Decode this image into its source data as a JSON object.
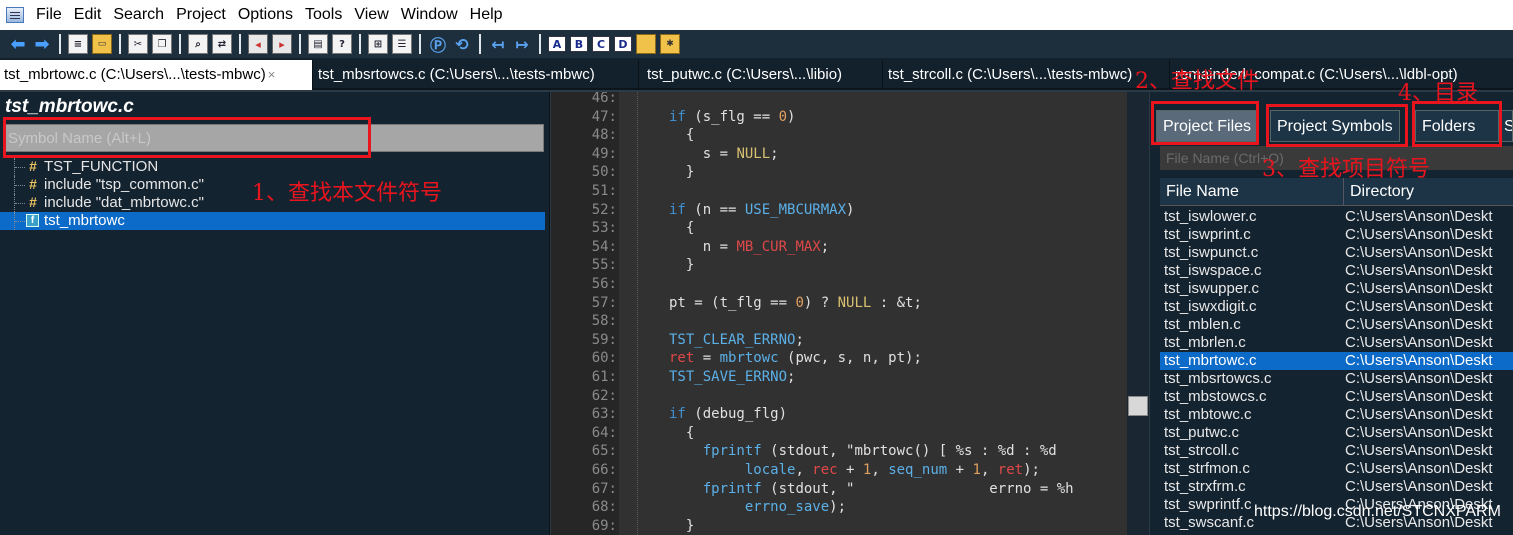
{
  "menu": [
    "File",
    "Edit",
    "Search",
    "Project",
    "Options",
    "Tools",
    "View",
    "Window",
    "Help"
  ],
  "toolbar": {
    "letters": [
      "A",
      "B",
      "C",
      "D"
    ]
  },
  "tabs": [
    {
      "label": "tst_mbrtowc.c (C:\\Users\\...\\tests-mbwc)",
      "active": true,
      "close": "×"
    },
    {
      "label": "tst_mbsrtowcs.c (C:\\Users\\...\\tests-mbwc)",
      "active": false
    },
    {
      "label": "tst_putwc.c (C:\\Users\\...\\libio)",
      "active": false
    },
    {
      "label": "tst_strcoll.c (C:\\Users\\...\\tests-mbwc)",
      "active": false
    },
    {
      "label": "remainderl_compat.c (C:\\Users\\...\\ldbl-opt)",
      "active": false
    }
  ],
  "left_panel": {
    "title": "tst_mbrtowc.c",
    "search_placeholder": "Symbol Name (Alt+L)",
    "symbols": [
      {
        "icon": "hash-icon",
        "label": "TST_FUNCTION",
        "selected": false
      },
      {
        "icon": "hash-icon",
        "label": "include \"tsp_common.c\"",
        "selected": false
      },
      {
        "icon": "hash-icon",
        "label": "include \"dat_mbrtowc.c\"",
        "selected": false
      },
      {
        "icon": "function-icon",
        "label": "tst_mbrtowc",
        "selected": true
      }
    ]
  },
  "editor": {
    "lines": [
      {
        "n": "46:",
        "html": ""
      },
      {
        "n": "47:",
        "html": "<span class=\"kw\">if</span> (s_flg == <span class=\"num\">0</span>)"
      },
      {
        "n": "48:",
        "html": "  {"
      },
      {
        "n": "49:",
        "html": "    s = <span class=\"yel\">NULL</span>;"
      },
      {
        "n": "50:",
        "html": "  }"
      },
      {
        "n": "51:",
        "html": ""
      },
      {
        "n": "52:",
        "html": "<span class=\"kw\">if</span> (n == <span class=\"cyan\">USE_MBCURMAX</span>)"
      },
      {
        "n": "53:",
        "html": "  {"
      },
      {
        "n": "54:",
        "html": "    n = <span class=\"red\">MB_CUR_MAX</span>;"
      },
      {
        "n": "55:",
        "html": "  }"
      },
      {
        "n": "56:",
        "html": ""
      },
      {
        "n": "57:",
        "html": "pt = (t_flg == <span class=\"num\">0</span>) ? <span class=\"yel\">NULL</span> : &amp;t;"
      },
      {
        "n": "58:",
        "html": ""
      },
      {
        "n": "59:",
        "html": "<span class=\"cyan\">TST_CLEAR_ERRNO</span>;"
      },
      {
        "n": "60:",
        "html": "<span class=\"red\">ret</span> = <span class=\"cyan\">mbrtowc</span> (pwc, s, n, pt);"
      },
      {
        "n": "61:",
        "html": "<span class=\"cyan\">TST_SAVE_ERRNO</span>;"
      },
      {
        "n": "62:",
        "html": ""
      },
      {
        "n": "63:",
        "html": "<span class=\"kw\">if</span> (debug_flg)"
      },
      {
        "n": "64:",
        "html": "  {"
      },
      {
        "n": "65:",
        "html": "    <span class=\"cyan\">fprintf</span> (stdout, \"mbrtowc() [ %s : %d : %d"
      },
      {
        "n": "66:",
        "html": "         <span class=\"cyan\">locale</span>, <span class=\"red\">rec</span> + <span class=\"num\">1</span>, <span class=\"cyan\">seq_num</span> + <span class=\"num\">1</span>, <span class=\"red\">ret</span>);"
      },
      {
        "n": "67:",
        "html": "    <span class=\"cyan\">fprintf</span> (stdout, \"                errno = %h"
      },
      {
        "n": "68:",
        "html": "         <span class=\"cyan\">errno_save</span>);"
      },
      {
        "n": "69:",
        "html": "  }"
      }
    ]
  },
  "right_panel": {
    "tabs": [
      "Project Files",
      "Project Symbols",
      "Folders",
      "S"
    ],
    "filter_placeholder": "File Name (Ctrl+O)",
    "col_file": "File Name",
    "col_dir": "Directory",
    "files": [
      {
        "name": "tst_iswlower.c",
        "dir": "C:\\Users\\Anson\\Deskt",
        "selected": false
      },
      {
        "name": "tst_iswprint.c",
        "dir": "C:\\Users\\Anson\\Deskt",
        "selected": false
      },
      {
        "name": "tst_iswpunct.c",
        "dir": "C:\\Users\\Anson\\Deskt",
        "selected": false
      },
      {
        "name": "tst_iswspace.c",
        "dir": "C:\\Users\\Anson\\Deskt",
        "selected": false
      },
      {
        "name": "tst_iswupper.c",
        "dir": "C:\\Users\\Anson\\Deskt",
        "selected": false
      },
      {
        "name": "tst_iswxdigit.c",
        "dir": "C:\\Users\\Anson\\Deskt",
        "selected": false
      },
      {
        "name": "tst_mblen.c",
        "dir": "C:\\Users\\Anson\\Deskt",
        "selected": false
      },
      {
        "name": "tst_mbrlen.c",
        "dir": "C:\\Users\\Anson\\Deskt",
        "selected": false
      },
      {
        "name": "tst_mbrtowc.c",
        "dir": "C:\\Users\\Anson\\Deskt",
        "selected": true
      },
      {
        "name": "tst_mbsrtowcs.c",
        "dir": "C:\\Users\\Anson\\Deskt",
        "selected": false
      },
      {
        "name": "tst_mbstowcs.c",
        "dir": "C:\\Users\\Anson\\Deskt",
        "selected": false
      },
      {
        "name": "tst_mbtowc.c",
        "dir": "C:\\Users\\Anson\\Deskt",
        "selected": false
      },
      {
        "name": "tst_putwc.c",
        "dir": "C:\\Users\\Anson\\Deskt",
        "selected": false
      },
      {
        "name": "tst_strcoll.c",
        "dir": "C:\\Users\\Anson\\Deskt",
        "selected": false
      },
      {
        "name": "tst_strfmon.c",
        "dir": "C:\\Users\\Anson\\Deskt",
        "selected": false
      },
      {
        "name": "tst_strxfrm.c",
        "dir": "C:\\Users\\Anson\\Deskt",
        "selected": false
      },
      {
        "name": "tst_swprintf.c",
        "dir": "C:\\Users\\Anson\\Deskt",
        "selected": false
      },
      {
        "name": "tst_swscanf.c",
        "dir": "C:\\Users\\Anson\\Deskt",
        "selected": false
      }
    ]
  },
  "annotations": {
    "a1": "1、查找本文件符号",
    "a2": "2、查找文件",
    "a3": "3、查找项目符号",
    "a4": "4、目录"
  },
  "watermark": "https://blog.csdn.net/STCNXPARM",
  "colors": {
    "annotation": "#e8141e",
    "selection": "#0c6ac8",
    "panel_bg": "#142330"
  }
}
